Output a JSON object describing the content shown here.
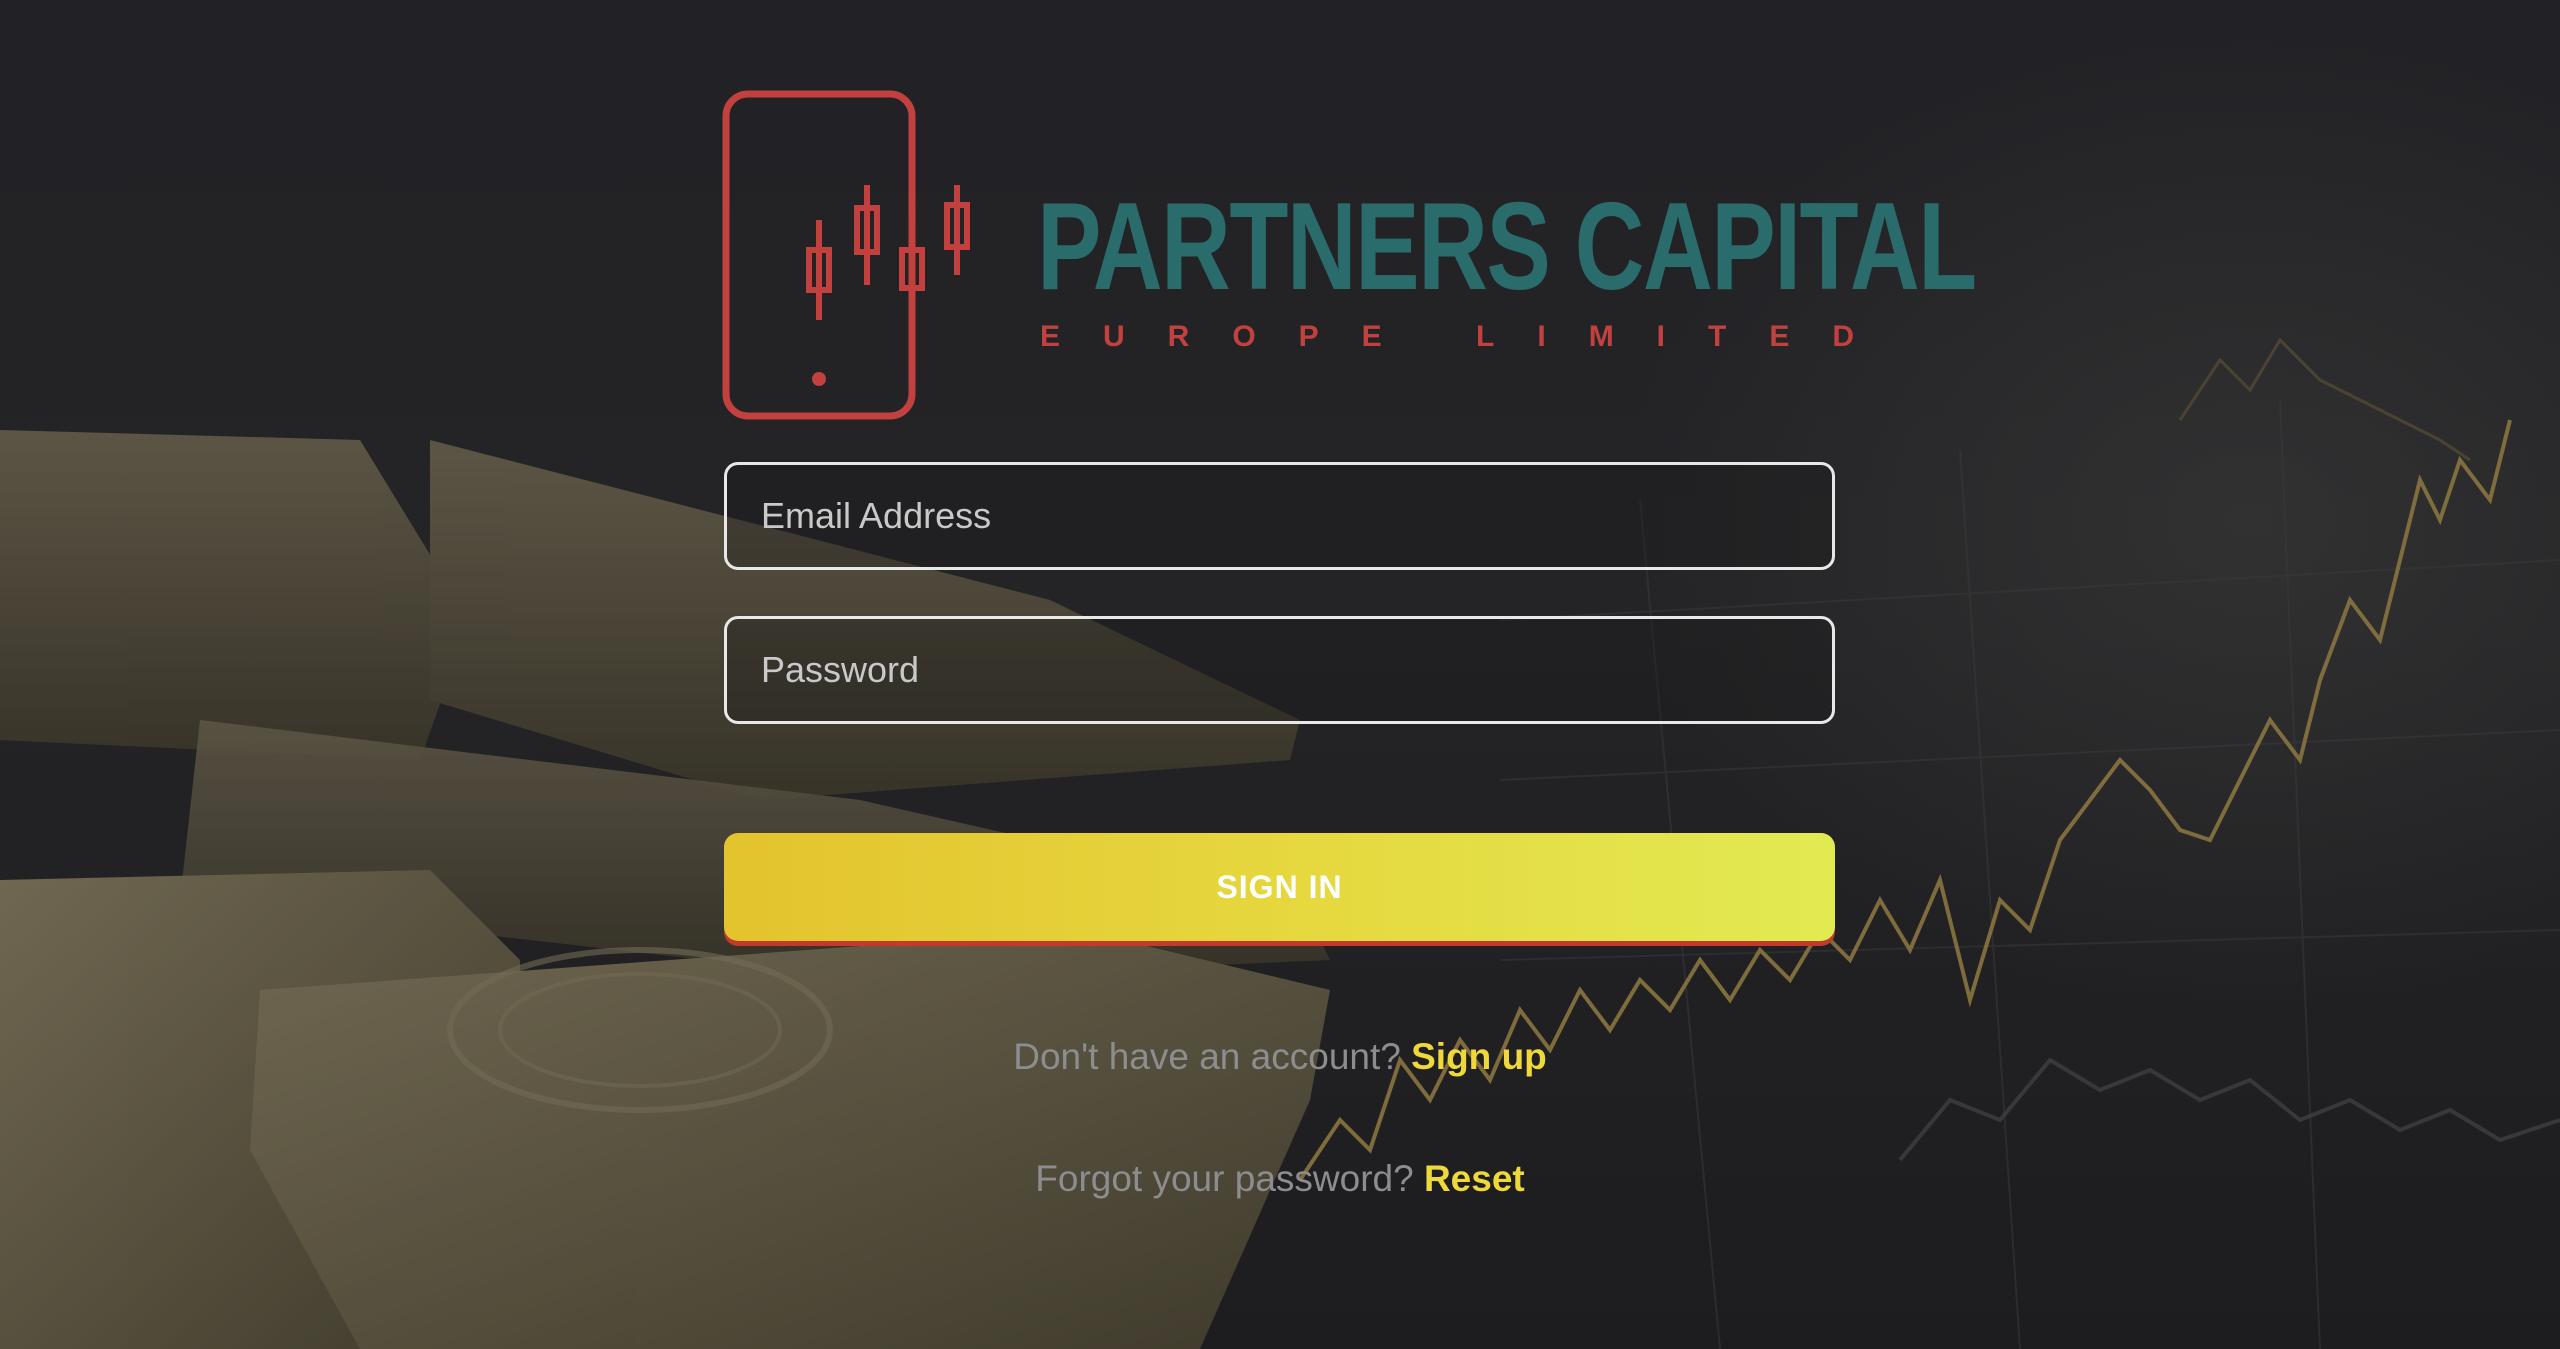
{
  "brand": {
    "name": "PARTNERS CAPITAL",
    "subtitle": "EUROPE LIMITED",
    "colors": {
      "primary": "#2a6b6b",
      "accent": "#c2413e"
    }
  },
  "form": {
    "email_placeholder": "Email Address",
    "password_placeholder": "Password",
    "submit_label": "SIGN IN"
  },
  "signup": {
    "prompt": "Don't have an account?",
    "link": "Sign up"
  },
  "reset": {
    "prompt": "Forgot your password?",
    "link": "Reset"
  },
  "theme": {
    "button_color": "#e6d73e",
    "link_color": "#efd83a"
  },
  "icons": {
    "logo": "phone-candlestick-icon"
  }
}
